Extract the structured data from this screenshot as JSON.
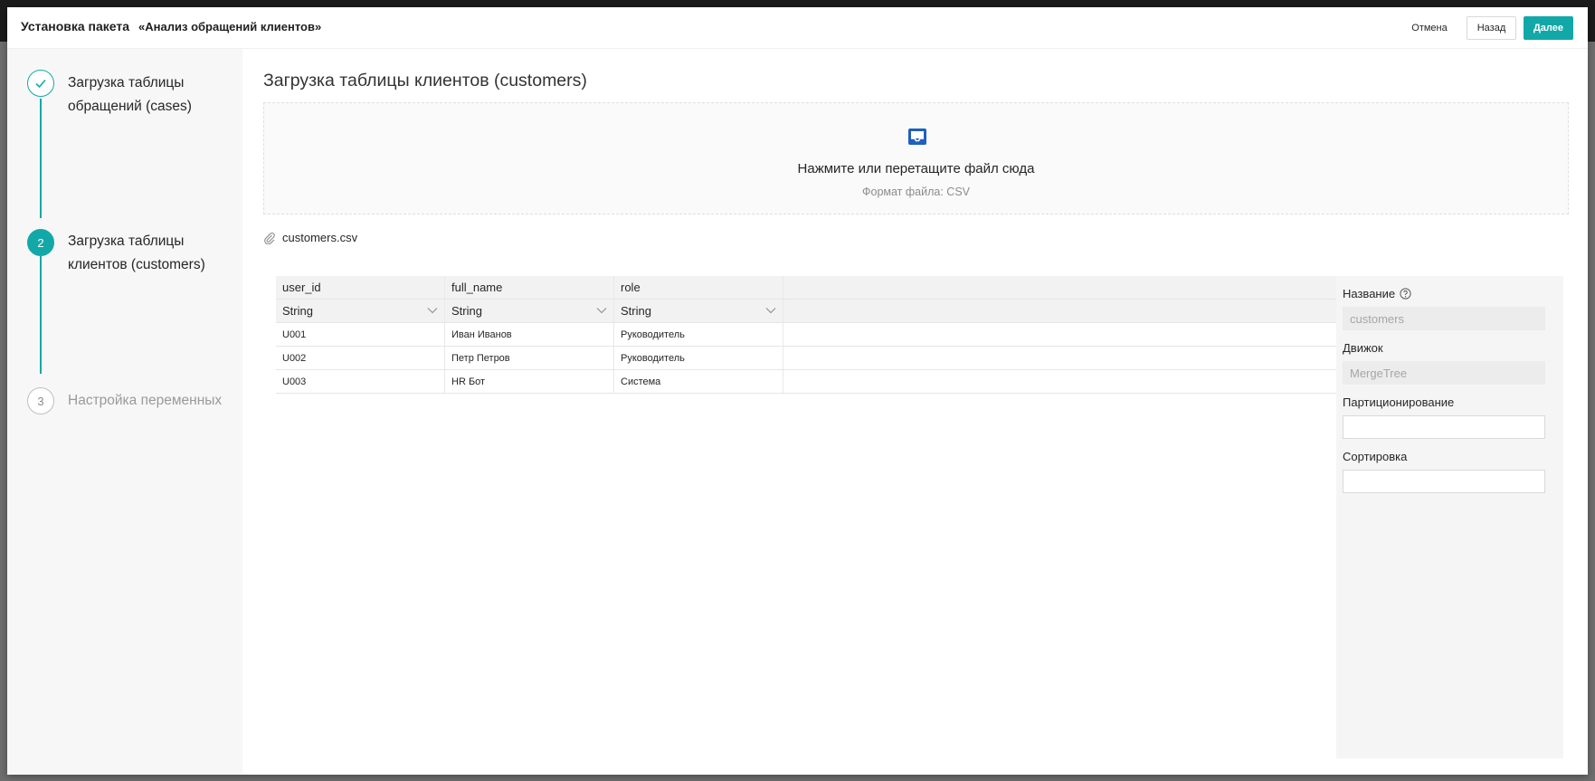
{
  "header": {
    "title_prefix": "Установка пакета",
    "package_name": "«Анализ обращений клиентов»",
    "cancel_label": "Отмена",
    "back_label": "Назад",
    "next_label": "Далее"
  },
  "steps": [
    {
      "number": "",
      "label": "Загрузка таблицы обращений (cases)",
      "status": "done",
      "icon": "check-icon"
    },
    {
      "number": "2",
      "label": "Загрузка таблицы клиентов (customers)",
      "status": "active"
    },
    {
      "number": "3",
      "label": "Настройка переменных",
      "status": "wait"
    }
  ],
  "main": {
    "title": "Загрузка таблицы клиентов (customers)",
    "upload": {
      "icon": "inbox-icon",
      "main_text": "Нажмите или перетащите файл сюда",
      "sub_text": "Формат файла: CSV"
    },
    "file": {
      "icon": "paperclip-icon",
      "name": "customers.csv"
    }
  },
  "table": {
    "columns": [
      {
        "name": "user_id",
        "type": "String"
      },
      {
        "name": "full_name",
        "type": "String"
      },
      {
        "name": "role",
        "type": "String"
      }
    ],
    "rows": [
      [
        "U001",
        "Иван Иванов",
        "Руководитель"
      ],
      [
        "U002",
        "Петр Петров",
        "Руководитель"
      ],
      [
        "U003",
        "HR Бот",
        "Система"
      ]
    ]
  },
  "properties": {
    "name_label": "Название",
    "name_value": "customers",
    "engine_label": "Движок",
    "engine_value": "MergeTree",
    "partition_label": "Партиционирование",
    "partition_value": "",
    "sort_label": "Сортировка",
    "sort_value": ""
  },
  "colors": {
    "accent": "#13a8a8",
    "upload_icon": "#1f5fbf"
  }
}
